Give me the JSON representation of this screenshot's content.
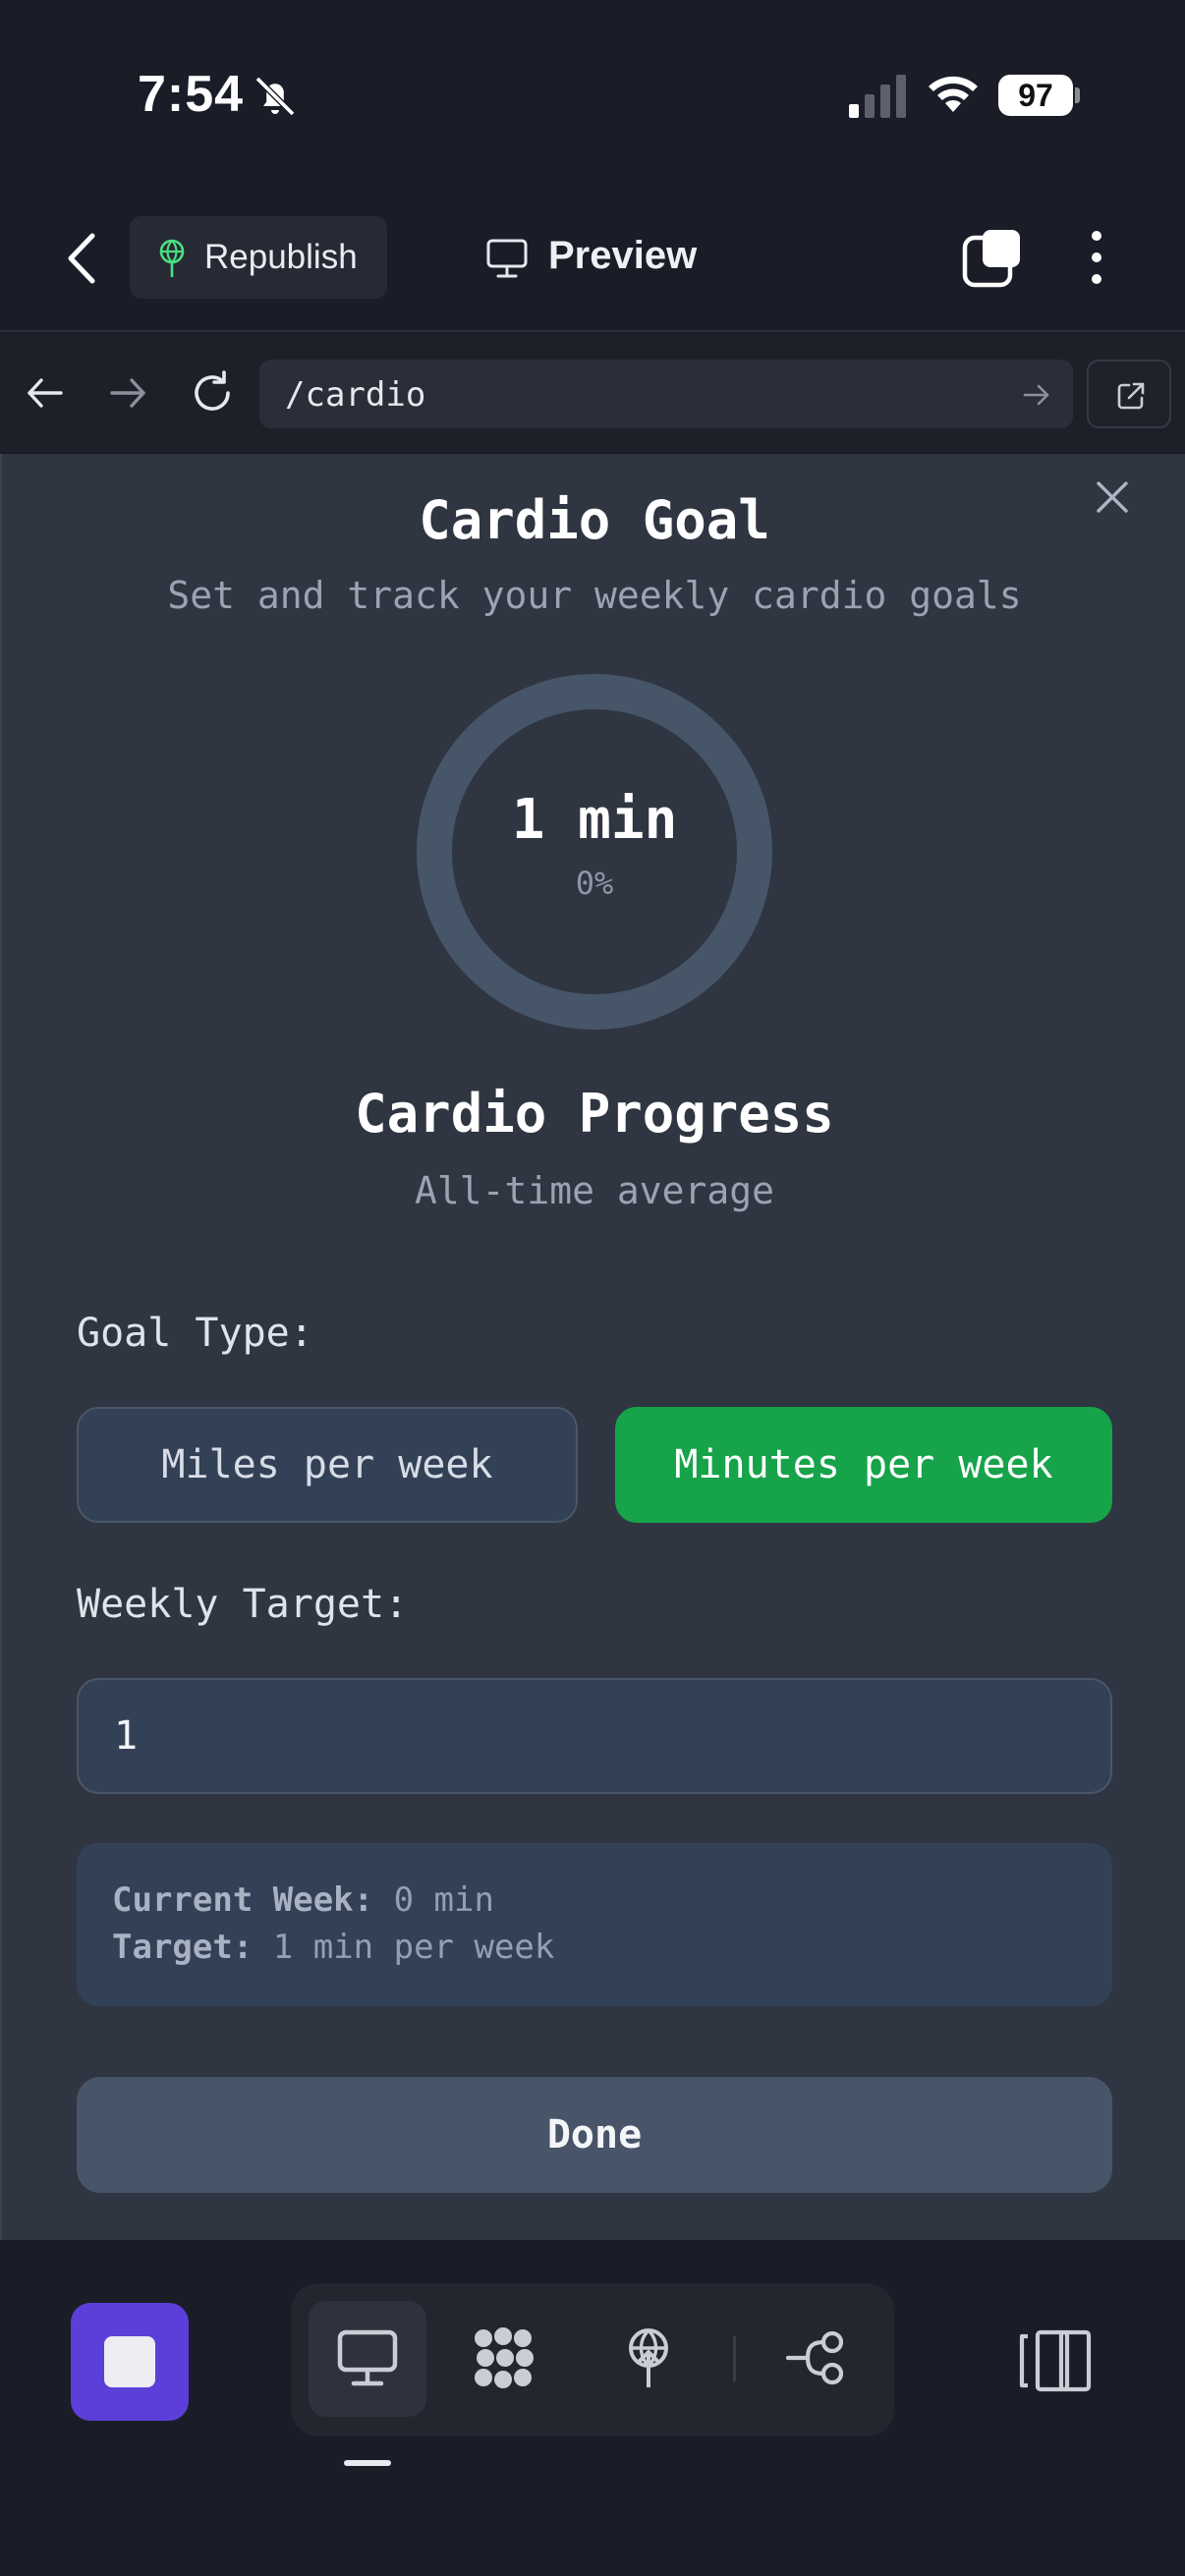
{
  "status_bar": {
    "time": "7:54",
    "battery": "97"
  },
  "header": {
    "republish_label": "Republish",
    "preview_label": "Preview"
  },
  "browser": {
    "url": "/cardio"
  },
  "modal": {
    "title": "Cardio Goal",
    "subtitle": "Set and track your weekly cardio goals",
    "ring": {
      "value": "1 min",
      "percent": "0%",
      "progress_fraction": 0
    },
    "progress_title": "Cardio Progress",
    "progress_subtitle": "All-time average",
    "goal_type_label": "Goal Type:",
    "goal_options": {
      "miles": "Miles per week",
      "minutes": "Minutes per week"
    },
    "selected_goal": "minutes",
    "weekly_target_label": "Weekly Target:",
    "weekly_target_value": "1",
    "summary": {
      "current_week_label": "Current Week:",
      "current_week_value": "0 min",
      "target_label": "Target:",
      "target_value": "1 min per week"
    },
    "done_label": "Done"
  },
  "colors": {
    "accent_green": "#16a34a",
    "stop_purple": "#5b3fd8",
    "republish_green": "#4ade80"
  },
  "icons": {
    "back": "chevron-left-icon",
    "republish": "antenna-icon",
    "preview": "monitor-icon",
    "tabs": "tabs-icon",
    "menu": "kebab-icon",
    "close": "close-icon",
    "stop": "stop-icon",
    "tools": [
      "monitor-icon",
      "dots-grid-icon",
      "antenna-icon",
      "workflow-icon"
    ],
    "panel": "panel-toggle-icon"
  }
}
